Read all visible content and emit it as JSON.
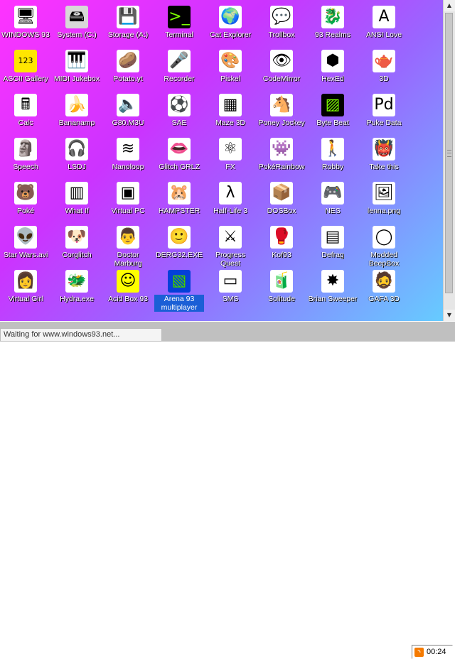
{
  "desktop": {
    "icons": [
      {
        "label": "WINDOWS 93",
        "glyph": "🖥",
        "bg": "#ffffff"
      },
      {
        "label": "System (C:)",
        "glyph": "🖴",
        "bg": "#d8d8d8"
      },
      {
        "label": "Storage (A:)",
        "glyph": "💾",
        "bg": "#ffffff"
      },
      {
        "label": "Terminal",
        "glyph": ">_",
        "bg": "#000000"
      },
      {
        "label": "Cat Explorer",
        "glyph": "🌍",
        "bg": "#ffffff"
      },
      {
        "label": "Trollbox",
        "glyph": "💬",
        "bg": "#ffffff"
      },
      {
        "label": "93 Realms",
        "glyph": "🐉",
        "bg": "#ffffff"
      },
      {
        "label": "ANSI Love",
        "glyph": "A",
        "bg": "#ffffff"
      },
      {
        "label": "ASCII Gallery",
        "glyph": "123",
        "bg": "#ffe600"
      },
      {
        "label": "MIDI Jukebox",
        "glyph": "🎹",
        "bg": "#ffffff"
      },
      {
        "label": "Potato.yt",
        "glyph": "🥔",
        "bg": "#ffffff"
      },
      {
        "label": "Recorder",
        "glyph": "🎤",
        "bg": "#ffffff"
      },
      {
        "label": "Piskel",
        "glyph": "🎨",
        "bg": "#ffffff"
      },
      {
        "label": "CodeMirror",
        "glyph": "👁",
        "bg": "#ffffff"
      },
      {
        "label": "HexEd",
        "glyph": "⬢",
        "bg": "#ffffff"
      },
      {
        "label": "3D",
        "glyph": "🫖",
        "bg": "#ffffff"
      },
      {
        "label": "Calc",
        "glyph": "🖩",
        "bg": "#ffffff"
      },
      {
        "label": "Bananamp",
        "glyph": "🍌",
        "bg": "#ffffff"
      },
      {
        "label": "G80.M3U",
        "glyph": "🔈",
        "bg": "#ffffff"
      },
      {
        "label": "SAE",
        "glyph": "⚽",
        "bg": "#ffffff"
      },
      {
        "label": "Maze 3D",
        "glyph": "▦",
        "bg": "#ffffff"
      },
      {
        "label": "Poney Jockey",
        "glyph": "🐴",
        "bg": "#ffffff"
      },
      {
        "label": "Byte Beat",
        "glyph": "▨",
        "bg": "#000000"
      },
      {
        "label": "Puke Data",
        "glyph": "Pd",
        "bg": "#ffffff"
      },
      {
        "label": "Speech",
        "glyph": "🗿",
        "bg": "#ffffff"
      },
      {
        "label": "LSDJ",
        "glyph": "🎧",
        "bg": "#ffffff"
      },
      {
        "label": "Nanoloop",
        "glyph": "≋",
        "bg": "#ffffff"
      },
      {
        "label": "Glitch GRLZ",
        "glyph": "👄",
        "bg": "#ffffff"
      },
      {
        "label": "FX",
        "glyph": "⚛",
        "bg": "#ffffff"
      },
      {
        "label": "PokéRainbow",
        "glyph": "👾",
        "bg": "#ffffff"
      },
      {
        "label": "Robby",
        "glyph": "🚶",
        "bg": "#ffffff"
      },
      {
        "label": "Take this",
        "glyph": "👹",
        "bg": "#ffffff"
      },
      {
        "label": "Poké",
        "glyph": "🐻",
        "bg": "#ffffff"
      },
      {
        "label": "What If",
        "glyph": "▥",
        "bg": "#ffffff"
      },
      {
        "label": "Virtual PC",
        "glyph": "▣",
        "bg": "#ffffff"
      },
      {
        "label": "HAMPSTER",
        "glyph": "🐹",
        "bg": "#ffffff"
      },
      {
        "label": "Half-Life 3",
        "glyph": "λ",
        "bg": "#ffffff"
      },
      {
        "label": "DOSBox",
        "glyph": "📦",
        "bg": "#ffffff"
      },
      {
        "label": "NES",
        "glyph": "🎮",
        "bg": "#ffffff"
      },
      {
        "label": "lenna.png",
        "glyph": "🖼",
        "bg": "#ffffff"
      },
      {
        "label": "Star Wars.avi",
        "glyph": "👽",
        "bg": "#ffffff"
      },
      {
        "label": "Corglitch",
        "glyph": "🐶",
        "bg": "#ffffff"
      },
      {
        "label": "Doctor Marburg",
        "glyph": "👨",
        "bg": "#ffffff"
      },
      {
        "label": "DERG32.EXE",
        "glyph": "🙂",
        "bg": "#ffffff"
      },
      {
        "label": "Progress Quest",
        "glyph": "⚔",
        "bg": "#ffffff"
      },
      {
        "label": "Kof93",
        "glyph": "🥊",
        "bg": "#ffffff"
      },
      {
        "label": "Defrag",
        "glyph": "▤",
        "bg": "#ffffff"
      },
      {
        "label": "Modded BeepBox",
        "glyph": "◯",
        "bg": "#ffffff"
      },
      {
        "label": "Virtual Girl",
        "glyph": "👩",
        "bg": "#ffffff"
      },
      {
        "label": "Hydra.exe",
        "glyph": "🐲",
        "bg": "#ffffff"
      },
      {
        "label": "Acid Box 93",
        "glyph": "☺",
        "bg": "#ffff00"
      },
      {
        "label": "Arena 93 multiplayer",
        "glyph": "▧",
        "bg": "#1a4fd8"
      },
      {
        "label": "SMS",
        "glyph": "▭",
        "bg": "#ffffff"
      },
      {
        "label": "Solitude",
        "glyph": "🧃",
        "bg": "#ffffff"
      },
      {
        "label": "Brian Sweeper",
        "glyph": "✸",
        "bg": "#ffffff"
      },
      {
        "label": "GAFA 3D",
        "glyph": "🧔",
        "bg": "#ffffff"
      }
    ],
    "selected_label": "Arena 93 multiplayer"
  },
  "statusbar": {
    "text": "Waiting for www.windows93.net..."
  },
  "taskbar": {
    "clock": "00:24",
    "tray_icon": "rss-icon"
  },
  "scrollbar": {
    "up": "▲",
    "down": "▼"
  }
}
